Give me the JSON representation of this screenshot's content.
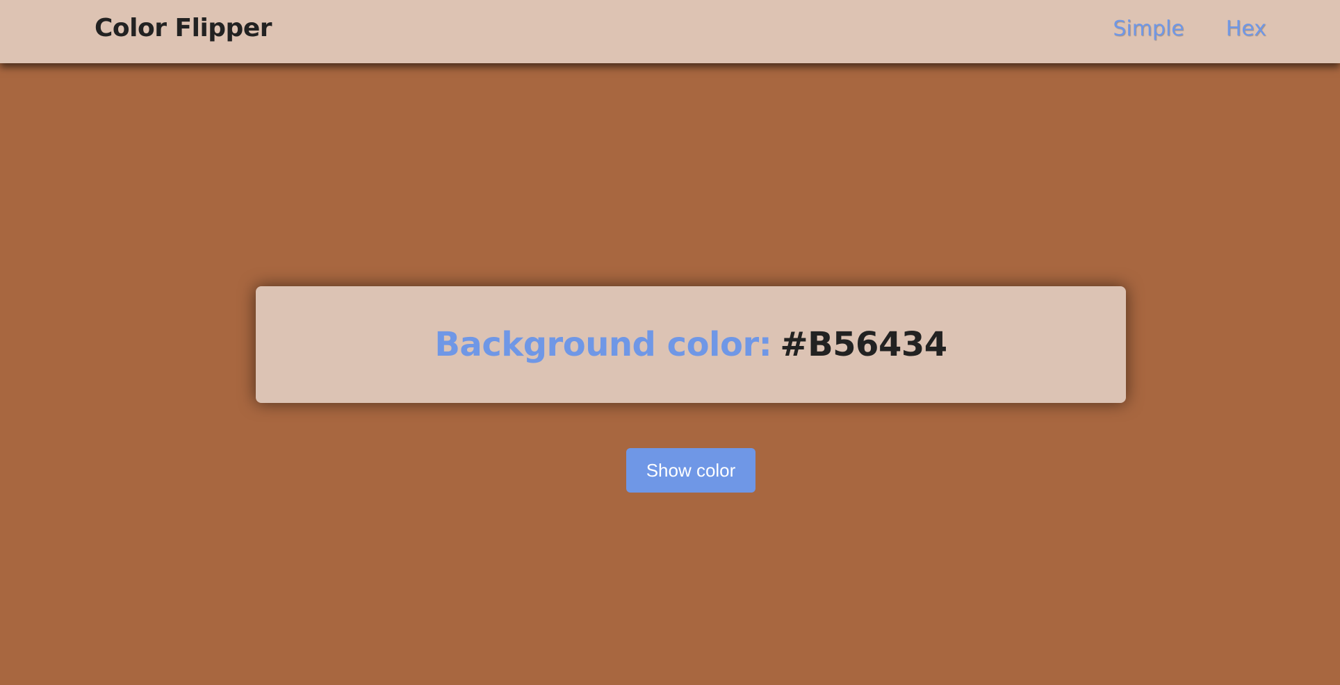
{
  "header": {
    "brand": "Color Flipper",
    "nav": [
      {
        "label": "Simple"
      },
      {
        "label": "Hex"
      }
    ]
  },
  "main": {
    "label": "Background color:",
    "value": "#B56434",
    "button_label": "Show color"
  },
  "colors": {
    "page_background": "#A86740",
    "panel_background": "#DCC3B4",
    "accent": "#6F97E6",
    "text_dark": "#222222"
  }
}
